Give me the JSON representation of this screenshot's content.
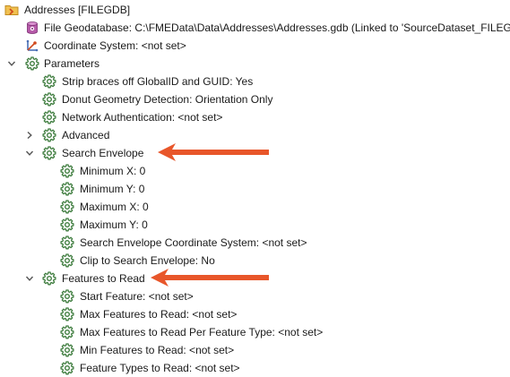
{
  "tree": {
    "root": {
      "label": "Addresses [FILEGDB]",
      "icon": "folder-chevron-icon"
    },
    "dataset": {
      "label": "File Geodatabase: C:\\FMEData\\Data\\Addresses\\Addresses.gdb (Linked to 'SourceDataset_FILEGDB')",
      "icon": "geodatabase-icon"
    },
    "coord": {
      "label": "Coordinate System: <not set>",
      "icon": "coordinate-system-icon"
    },
    "parameters": {
      "label": "Parameters",
      "items": [
        "Strip braces off GlobalID and GUID: Yes",
        "Donut Geometry Detection: Orientation Only",
        "Network Authentication: <not set>"
      ],
      "advanced": "Advanced",
      "search_envelope": {
        "label": "Search Envelope",
        "items": [
          "Minimum X: 0",
          "Minimum Y: 0",
          "Maximum X: 0",
          "Maximum Y: 0",
          "Search Envelope Coordinate System: <not set>",
          "Clip to Search Envelope: No"
        ]
      },
      "features_to_read": {
        "label": "Features to Read",
        "items": [
          "Start Feature: <not set>",
          "Max Features to Read: <not set>",
          "Max Features to Read Per Feature Type: <not set>",
          "Min Features to Read: <not set>",
          "Feature Types to Read: <not set>"
        ]
      }
    }
  },
  "colors": {
    "gear": "#3f7d3f",
    "arrow": "#e8562a",
    "chevron": "#555555"
  }
}
